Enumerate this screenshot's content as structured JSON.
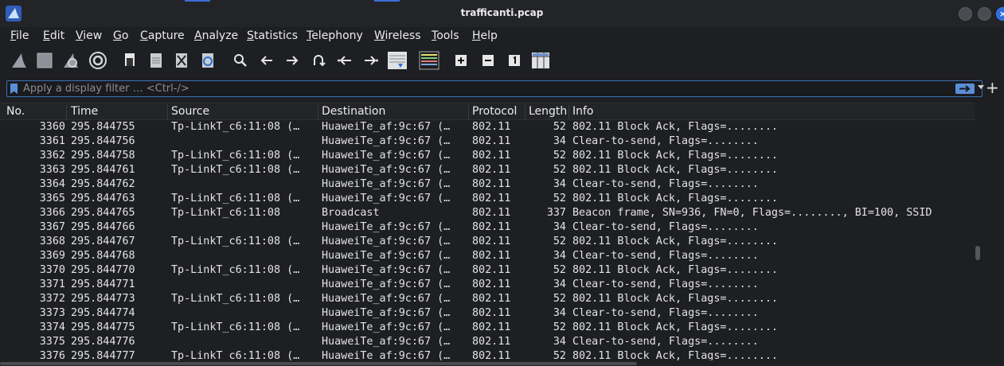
{
  "window": {
    "title": "trafficanti.pcap"
  },
  "menu": [
    {
      "label": "File",
      "u": "F",
      "rest": "ile"
    },
    {
      "label": "Edit",
      "u": "E",
      "rest": "dit"
    },
    {
      "label": "View",
      "u": "V",
      "rest": "iew"
    },
    {
      "label": "Go",
      "u": "G",
      "rest": "o"
    },
    {
      "label": "Capture",
      "u": "C",
      "rest": "apture"
    },
    {
      "label": "Analyze",
      "u": "A",
      "rest": "nalyze"
    },
    {
      "label": "Statistics",
      "u": "S",
      "rest": "tatistics"
    },
    {
      "label": "Telephony",
      "u": "T",
      "rest": "elephony"
    },
    {
      "label": "Wireless",
      "u": "W",
      "rest": "ireless"
    },
    {
      "label": "Tools",
      "u": "T",
      "rest": "ools"
    },
    {
      "label": "Help",
      "u": "H",
      "rest": "elp"
    }
  ],
  "toolbar": {
    "icons": [
      "start-capture-icon",
      "stop-capture-icon",
      "restart-capture-icon",
      "capture-options-icon",
      "open-file-icon",
      "save-file-icon",
      "close-file-icon",
      "reload-file-icon",
      "find-packet-icon",
      "go-back-icon",
      "go-forward-icon",
      "go-to-packet-icon",
      "first-packet-icon",
      "last-packet-icon",
      "auto-scroll-icon",
      "colorize-icon",
      "zoom-in-icon",
      "zoom-out-icon",
      "normal-size-icon",
      "resize-columns-icon"
    ]
  },
  "filter": {
    "placeholder": "Apply a display filter … <Ctrl-/>"
  },
  "columns": {
    "no": "No.",
    "time": "Time",
    "source": "Source",
    "destination": "Destination",
    "protocol": "Protocol",
    "length": "Length",
    "info": "Info"
  },
  "packets": [
    {
      "no": "3360",
      "time": "295.844755",
      "src": "Tp-LinkT_c6:11:08 (…",
      "dst": "HuaweiTe_af:9c:67 (…",
      "proto": "802.11",
      "len": "52",
      "info": "802.11 Block Ack, Flags=........"
    },
    {
      "no": "3361",
      "time": "295.844756",
      "src": "",
      "dst": "HuaweiTe_af:9c:67 (…",
      "proto": "802.11",
      "len": "34",
      "info": "Clear-to-send, Flags=........"
    },
    {
      "no": "3362",
      "time": "295.844758",
      "src": "Tp-LinkT_c6:11:08 (…",
      "dst": "HuaweiTe_af:9c:67 (…",
      "proto": "802.11",
      "len": "52",
      "info": "802.11 Block Ack, Flags=........"
    },
    {
      "no": "3363",
      "time": "295.844761",
      "src": "Tp-LinkT_c6:11:08 (…",
      "dst": "HuaweiTe_af:9c:67 (…",
      "proto": "802.11",
      "len": "52",
      "info": "802.11 Block Ack, Flags=........"
    },
    {
      "no": "3364",
      "time": "295.844762",
      "src": "",
      "dst": "HuaweiTe_af:9c:67 (…",
      "proto": "802.11",
      "len": "34",
      "info": "Clear-to-send, Flags=........"
    },
    {
      "no": "3365",
      "time": "295.844763",
      "src": "Tp-LinkT_c6:11:08 (…",
      "dst": "HuaweiTe_af:9c:67 (…",
      "proto": "802.11",
      "len": "52",
      "info": "802.11 Block Ack, Flags=........"
    },
    {
      "no": "3366",
      "time": "295.844765",
      "src": "Tp-LinkT_c6:11:08",
      "dst": "Broadcast",
      "proto": "802.11",
      "len": "337",
      "info": "Beacon frame, SN=936, FN=0, Flags=........, BI=100, SSID"
    },
    {
      "no": "3367",
      "time": "295.844766",
      "src": "",
      "dst": "HuaweiTe_af:9c:67 (…",
      "proto": "802.11",
      "len": "34",
      "info": "Clear-to-send, Flags=........"
    },
    {
      "no": "3368",
      "time": "295.844767",
      "src": "Tp-LinkT_c6:11:08 (…",
      "dst": "HuaweiTe_af:9c:67 (…",
      "proto": "802.11",
      "len": "52",
      "info": "802.11 Block Ack, Flags=........"
    },
    {
      "no": "3369",
      "time": "295.844768",
      "src": "",
      "dst": "HuaweiTe_af:9c:67 (…",
      "proto": "802.11",
      "len": "34",
      "info": "Clear-to-send, Flags=........"
    },
    {
      "no": "3370",
      "time": "295.844770",
      "src": "Tp-LinkT_c6:11:08 (…",
      "dst": "HuaweiTe_af:9c:67 (…",
      "proto": "802.11",
      "len": "52",
      "info": "802.11 Block Ack, Flags=........"
    },
    {
      "no": "3371",
      "time": "295.844771",
      "src": "",
      "dst": "HuaweiTe_af:9c:67 (…",
      "proto": "802.11",
      "len": "34",
      "info": "Clear-to-send, Flags=........"
    },
    {
      "no": "3372",
      "time": "295.844773",
      "src": "Tp-LinkT_c6:11:08 (…",
      "dst": "HuaweiTe_af:9c:67 (…",
      "proto": "802.11",
      "len": "52",
      "info": "802.11 Block Ack, Flags=........"
    },
    {
      "no": "3373",
      "time": "295.844774",
      "src": "",
      "dst": "HuaweiTe_af:9c:67 (…",
      "proto": "802.11",
      "len": "34",
      "info": "Clear-to-send, Flags=........"
    },
    {
      "no": "3374",
      "time": "295.844775",
      "src": "Tp-LinkT_c6:11:08 (…",
      "dst": "HuaweiTe_af:9c:67 (…",
      "proto": "802.11",
      "len": "52",
      "info": "802.11 Block Ack, Flags=........"
    },
    {
      "no": "3375",
      "time": "295.844776",
      "src": "",
      "dst": "HuaweiTe_af:9c:67 (…",
      "proto": "802.11",
      "len": "34",
      "info": "Clear-to-send, Flags=........"
    },
    {
      "no": "3376",
      "time": "295.844777",
      "src": "Tp-LinkT_c6:11:08 (…",
      "dst": "HuaweiTe_af:9c:67 (…",
      "proto": "802.11",
      "len": "52",
      "info": "802.11 Block Ack, Flags=........"
    }
  ]
}
